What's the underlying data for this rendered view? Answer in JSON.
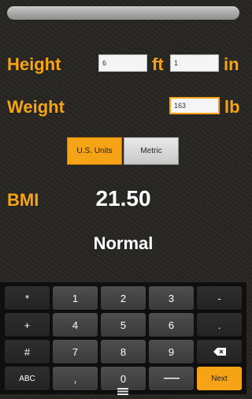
{
  "form": {
    "height_label": "Height",
    "height_feet": "6",
    "height_feet_unit": "ft",
    "height_inches": "1",
    "height_inches_unit": "in",
    "weight_label": "Weight",
    "weight_value": "163",
    "weight_unit": "lb"
  },
  "units": {
    "us_label": "U.S. Units",
    "metric_label": "Metric",
    "selected": "U.S. Units"
  },
  "result": {
    "bmi_label": "BMI",
    "bmi_value": "21.50",
    "category": "Normal"
  },
  "keyboard": {
    "rows": [
      [
        "*",
        "1",
        "2",
        "3",
        "-"
      ],
      [
        "+",
        "4",
        "5",
        "6",
        "."
      ],
      [
        "#",
        "7",
        "8",
        "9",
        "backspace"
      ],
      [
        "ABC",
        ",",
        "0",
        "space",
        "Next"
      ]
    ],
    "labels": {
      "star": "*",
      "one": "1",
      "two": "2",
      "three": "3",
      "minus": "-",
      "plus": "+",
      "four": "4",
      "five": "5",
      "six": "6",
      "period": ".",
      "hash": "#",
      "seven": "7",
      "eight": "8",
      "nine": "9",
      "abc": "ABC",
      "comma": ",",
      "zero": "0",
      "next": "Next"
    }
  },
  "icons": {
    "backspace": "backspace-icon",
    "space": "space-bar-icon",
    "nav": "nav-handle-icon"
  },
  "colors": {
    "accent": "#f6a316",
    "background": "#262421",
    "key": "#444444",
    "text": "#ffffff"
  }
}
